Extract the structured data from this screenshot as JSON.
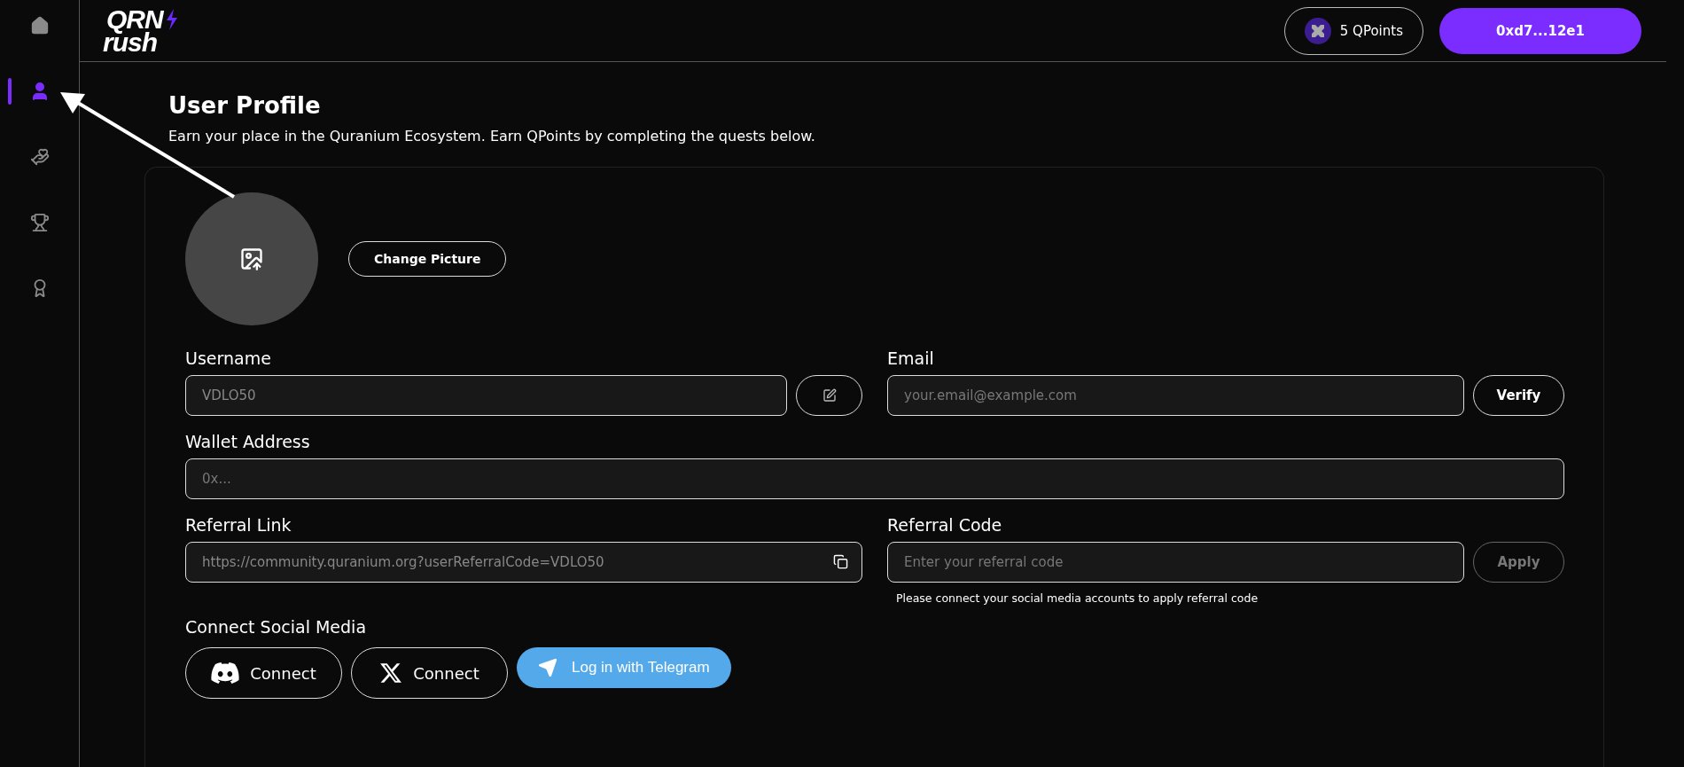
{
  "sidebar": {
    "items": [
      {
        "kind": "home",
        "selected": false
      },
      {
        "kind": "profile",
        "selected": true
      },
      {
        "kind": "quests",
        "selected": false
      },
      {
        "kind": "leaderboard",
        "selected": false
      },
      {
        "kind": "rewards",
        "selected": false
      }
    ]
  },
  "header": {
    "logo": {
      "top": "QRN",
      "bottom": "rush"
    },
    "points": "5 QPoints",
    "wallet_button": "0xd7...12e1"
  },
  "page": {
    "title": "User Profile",
    "subtitle": "Earn your place in the Quranium Ecosystem. Earn QPoints by completing the quests below."
  },
  "profile": {
    "change_picture": "Change Picture",
    "username": {
      "label": "Username",
      "value": "VDLO50"
    },
    "email": {
      "label": "Email",
      "placeholder": "your.email@example.com",
      "button": "Verify",
      "disabled": false
    },
    "wallet": {
      "label": "Wallet Address",
      "placeholder": "0x..."
    },
    "referral_link": {
      "label": "Referral Link",
      "value": "https://community.quranium.org?userReferralCode=VDLO50"
    },
    "referral_code": {
      "label": "Referral Code",
      "placeholder": "Enter your referral code",
      "button": "Apply",
      "disabled": true,
      "hint": "Please connect your social media accounts to apply referral code"
    },
    "social": {
      "label": "Connect Social Media",
      "buttons": [
        {
          "kind": "discord",
          "label": "Connect"
        },
        {
          "kind": "x",
          "label": "Connect"
        },
        {
          "kind": "telegram",
          "label": "Log in with Telegram"
        }
      ]
    }
  }
}
